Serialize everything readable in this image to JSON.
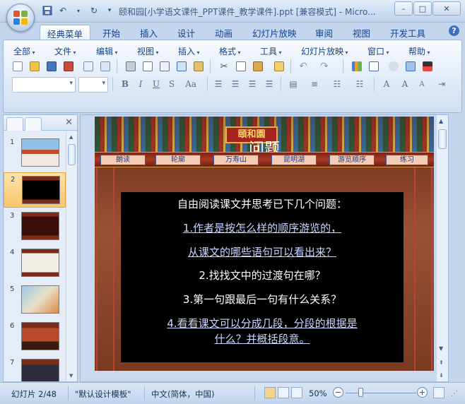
{
  "window": {
    "title": "颐和园[小学语文课件_PPT课件_教学课件].ppt [兼容模式] - Micro...",
    "controls": [
      "–",
      "□",
      "✕"
    ]
  },
  "tabs": [
    {
      "label": "经典菜单",
      "active": true
    },
    {
      "label": "开始"
    },
    {
      "label": "插入"
    },
    {
      "label": "设计"
    },
    {
      "label": "动画"
    },
    {
      "label": "幻灯片放映"
    },
    {
      "label": "审阅"
    },
    {
      "label": "视图"
    },
    {
      "label": "开发工具"
    }
  ],
  "menu": [
    "全部",
    "文件",
    "编辑",
    "视图",
    "插入",
    "格式",
    "工具",
    "幻灯片放映",
    "窗口",
    "帮助"
  ],
  "format_buttons": {
    "bold": "B",
    "italic": "I",
    "underline": "U",
    "strike": "S",
    "case": "Aa"
  },
  "slide_thumbs": [
    {
      "num": "1"
    },
    {
      "num": "2",
      "selected": true
    },
    {
      "num": "3"
    },
    {
      "num": "4"
    },
    {
      "num": "5"
    },
    {
      "num": "6"
    },
    {
      "num": "7"
    }
  ],
  "slide": {
    "title": "问题",
    "plaque": "頤和園",
    "nav": [
      "朗读",
      "轮廓",
      "万寿山",
      "昆明湖",
      "游览顺序",
      "练习"
    ],
    "lines": [
      {
        "text": "自由阅读课文并思考已下几个问题：",
        "link": false
      },
      {
        "text": "1.作者是按怎么样的顺序游览的，",
        "link": true
      },
      {
        "text": "从课文的哪些语句可以看出来？",
        "link": true
      },
      {
        "text": "2.找找文中的过渡句在哪？",
        "link": false
      },
      {
        "text": "3.第一句跟最后一句有什么关系？",
        "link": false
      },
      {
        "text": "4.看看课文可以分成几段，分段的根据是",
        "link": true
      },
      {
        "text": "什么？并概括段意。",
        "link": true
      }
    ]
  },
  "status": {
    "slide_info": "幻灯片 2/48",
    "template": "\"默认设计模板\"",
    "language": "中文(简体，中国)",
    "zoom": "50%"
  },
  "colors": {
    "accent": "#15428b",
    "slide_bg": "#8a4a2e",
    "content_bg": "#000000"
  }
}
